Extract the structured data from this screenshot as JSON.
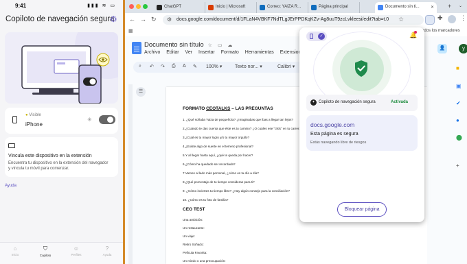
{
  "phone": {
    "time": "9:41",
    "status_icons": "▮▮▮ ≋ ▭",
    "title": "Copiloto de navegación segura",
    "device_card": {
      "visibility": "Visible",
      "device_name": "iPhone"
    },
    "link_card": {
      "title": "Vincula este dispositivo en la extensión",
      "body": "Encuentra tu dispositivo en la extensión del navegador y vincula tu móvil para comenzar."
    },
    "help_link": "Ayuda",
    "tabs": [
      {
        "label": "Inicio",
        "icon": "home-icon"
      },
      {
        "label": "Copiloto",
        "icon": "shield-icon"
      },
      {
        "label": "Perfiles",
        "icon": "profiles-icon"
      },
      {
        "label": "Ayuda",
        "icon": "help-icon"
      }
    ]
  },
  "browser": {
    "tabs": [
      {
        "title": "ChatGPT",
        "color": "#222222"
      },
      {
        "title": "Inicio | Microsoft",
        "color": "#d83b01"
      },
      {
        "title": "Correo: YAIZA R...",
        "color": "#0f6cbd"
      },
      {
        "title": "Página principal",
        "color": "#0f6cbd"
      },
      {
        "title": "Documento sin ti...",
        "color": "#4285f4"
      }
    ],
    "url": "docs.google.com/document/d/1FLaN4VBKF7NdTLgJErPPDKqKZv-Ag8uuT9zcLvkleesi/edit?tab=t.0",
    "bookmarks_label": "odos los marcadores"
  },
  "docs": {
    "title": "Documento sin título",
    "menu": [
      "Archivo",
      "Editar",
      "Ver",
      "Insertar",
      "Formato",
      "Herramientas",
      "Extensiones"
    ],
    "zoom": "100%",
    "style": "Texto nor...",
    "font": "Calibri",
    "heading_part1": "FORMATO ",
    "heading_link": "CEOTALKS",
    "heading_part2": " – LAS PREGUNTAS",
    "questions": [
      "1. ¿Qué soñaba Yaiza de pequeño/a? ¿Imaginabas que ibas a llegar tan lejos?",
      "2.¿Cuándo te das cuenta que éste es tu camino? ¿O cuáles ese \"click\" en tu carrera",
      "3.¿Cuál es tu mayor logro y/o tu mayor orgullo?",
      "4.¿Existe algo de suerte en el terreno profesional?",
      "5.Y al llegar hasta aquí, ¿qué te queda por hacer?",
      "6.¿Cómo ha quedado ser recordada?",
      "7.Vamos al lado más personal, ¿cómo es tu día a día?",
      "8.¿Qué porcentaje de tu tiempo consideras para ti?",
      "9. ¿Cómo inviertes tu tiempo libre? ¿Hay algún consejo para la conciliación?",
      "10. ¿Cómo es tu foto de familia?"
    ],
    "section2": "CEO TEST",
    "test_items": [
      "Una ambición:",
      "Un restaurante:",
      "Un viaje:",
      "Retiro Soñado:",
      "Película Favorita:",
      "Un miedo o una preocupación:"
    ]
  },
  "popup": {
    "copilot_label": "Copiloto de navegación segura",
    "copilot_status": "Activada",
    "site_domain": "docs.google.com",
    "site_status": "Esta página es segura",
    "site_sub": "Estás navegando libre de riesgos",
    "block_button": "Bloquear página"
  },
  "colors": {
    "accent": "#5a4ec0",
    "safe_green": "#1a8a3b",
    "shield_green": "#1f8a4c"
  }
}
